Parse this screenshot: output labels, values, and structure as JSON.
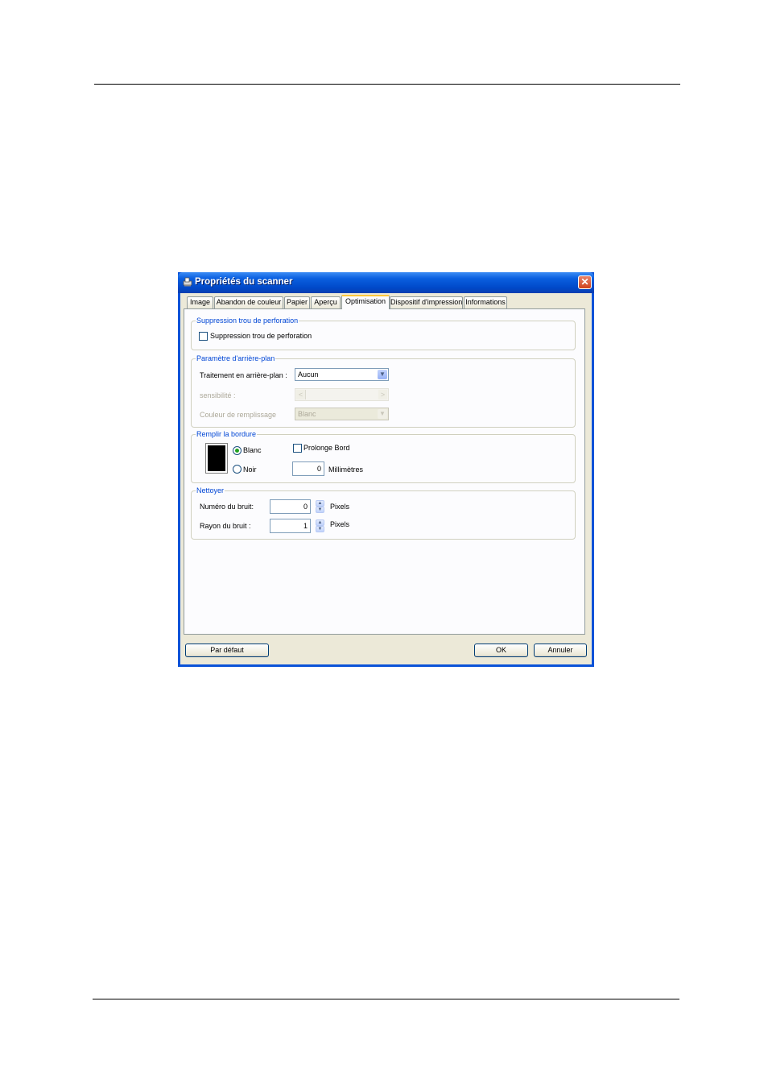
{
  "dialog": {
    "title": "Propriétés du scanner",
    "close_symbol": "✕"
  },
  "tabs": [
    {
      "label": "Image"
    },
    {
      "label": "Abandon de couleur"
    },
    {
      "label": "Papier"
    },
    {
      "label": "Aperçu"
    },
    {
      "label": "Optimisation",
      "active": true
    },
    {
      "label": "Dispositif d'impression"
    },
    {
      "label": "Informations"
    }
  ],
  "perforation": {
    "group_title": "Suppression trou de perforation",
    "checkbox_label": "Suppression trou de perforation",
    "checked": false
  },
  "background": {
    "group_title": "Paramètre d'arrière-plan",
    "processing_label": "Traitement en arrière-plan :",
    "processing_value": "Aucun",
    "sensitivity_label": "sensibilité :",
    "fill_color_label": "Couleur de remplissage",
    "fill_color_value": "Blanc"
  },
  "border": {
    "group_title": "Remplir la bordure",
    "white_label": "Blanc",
    "black_label": "Noir",
    "selected": "Blanc",
    "extend_label": "Prolonge Bord",
    "extend_checked": false,
    "mm_value": "0",
    "mm_label": "Millimètres"
  },
  "clean": {
    "group_title": "Nettoyer",
    "noise_number_label": "Numéro du bruit:",
    "noise_number_value": "0",
    "noise_number_unit": "Pixels",
    "noise_radius_label": "Rayon du bruit :",
    "noise_radius_value": "1",
    "noise_radius_unit": "Pixels"
  },
  "footer": {
    "default_label": "Par défaut",
    "ok_label": "OK",
    "cancel_label": "Annuler"
  },
  "icons": {
    "spin_up": "▲",
    "spin_down": "▼",
    "dropdown": "▼",
    "slider_left": "<",
    "slider_right": ">"
  }
}
